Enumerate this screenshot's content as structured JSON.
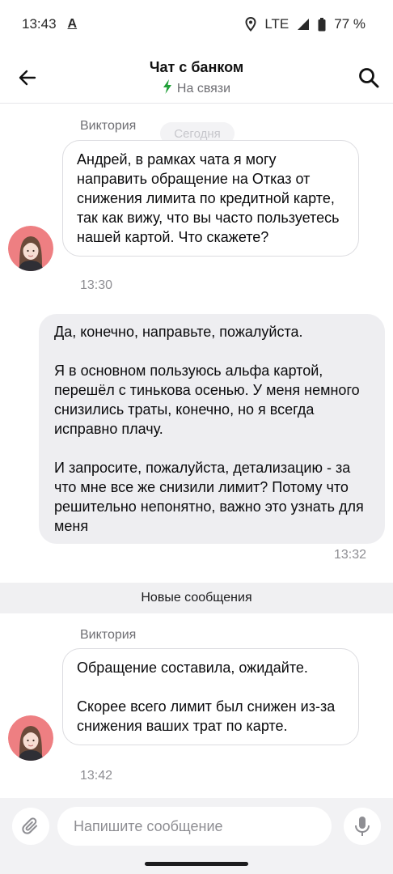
{
  "status_bar": {
    "time": "13:43",
    "app_indicator": "A",
    "network": "LTE",
    "battery": "77 %",
    "icons": [
      "location-icon",
      "signal-icon",
      "battery-icon"
    ]
  },
  "header": {
    "title": "Чат с банком",
    "status": "На связи",
    "status_color": "#21a038",
    "icons": [
      "back-arrow-icon",
      "lightning-icon",
      "search-icon"
    ]
  },
  "chat": {
    "date_chip": "Сегодня",
    "messages": [
      {
        "direction": "incoming",
        "sender": "Виктория",
        "text": "Андрей, в рамках чата я могу направить обращение на Отказ от снижения лимита по кредитной карте, так как вижу, что вы часто пользуетесь нашей картой. Что скажете?",
        "time": "13:30"
      },
      {
        "direction": "outgoing",
        "text": "Да, конечно, направьте, пожалуйста.\n\nЯ в основном пользуюсь альфа картой, перешёл с тинькова осенью. У меня немного снизились траты, конечно, но я всегда исправно плачу.\n\nИ запросите, пожалуйста, детализацию - за что мне все же снизили лимит? Потому что решительно непонятно, важно это узнать для меня",
        "time": "13:32"
      },
      {
        "direction": "incoming",
        "sender": "Виктория",
        "text": "Обращение составила, ожидайте.\n\nСкорее всего лимит был снижен из-за снижения ваших трат по карте.",
        "time": "13:42"
      }
    ],
    "new_messages_label": "Новые сообщения"
  },
  "composer": {
    "placeholder": "Напишите сообщение",
    "icons": [
      "paperclip-icon",
      "microphone-icon"
    ]
  },
  "colors": {
    "accent_green": "#21a038",
    "avatar_background": "#ee7f82",
    "outgoing_bubble": "#eeeef1",
    "incoming_border": "#dcdce0"
  }
}
